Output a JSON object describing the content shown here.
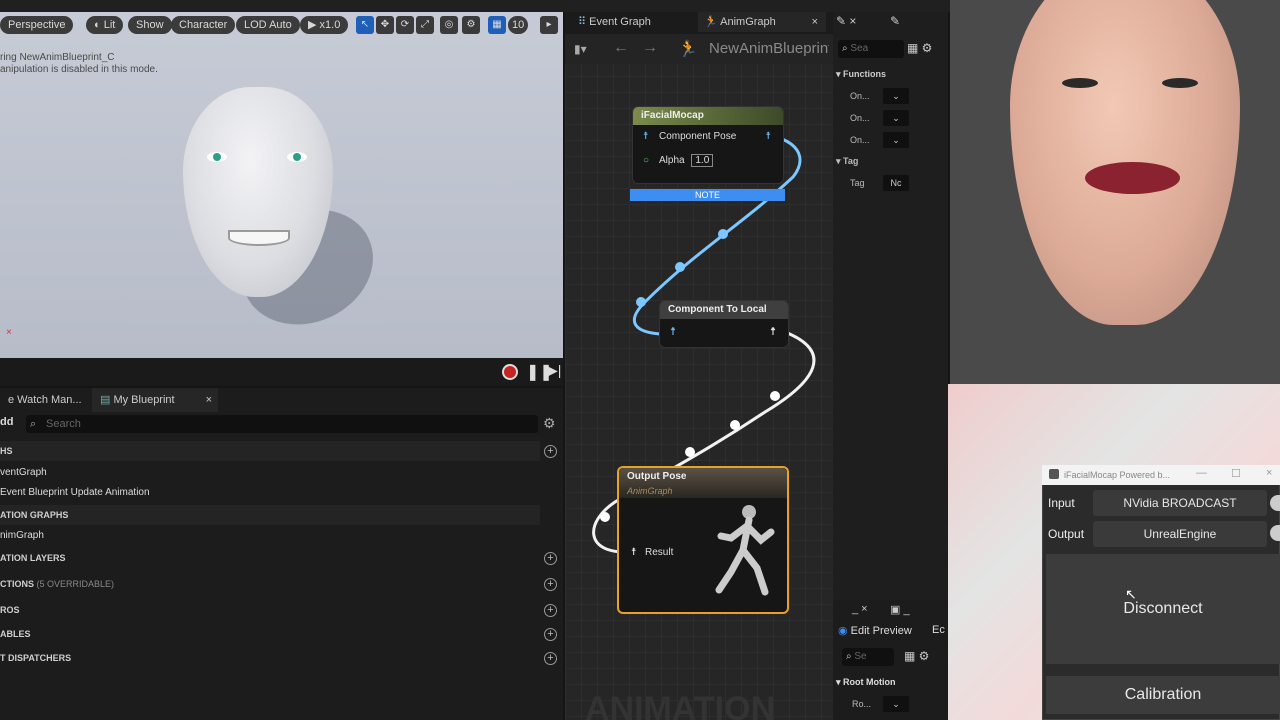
{
  "viewport": {
    "toolbar": [
      "Perspective",
      "Lit",
      "Show",
      "Character",
      "LOD Auto",
      "x1.0",
      "10"
    ],
    "message": "ring NewAnimBlueprint_C\nanipulation is disabled in this mode."
  },
  "blueprint": {
    "tabs": [
      "e Watch Man...",
      "My Blueprint"
    ],
    "add": "dd",
    "search_placeholder": "Search",
    "rows": [
      {
        "text": "HS",
        "sec": true
      },
      {
        "text": "ventGraph",
        "sec": false
      },
      {
        "text": " Event Blueprint Update Animation",
        "sec": false
      },
      {
        "text": "ATION GRAPHS",
        "sec": true
      },
      {
        "text": "nimGraph",
        "sec": false
      },
      {
        "text": "ATION LAYERS",
        "sec": true
      },
      {
        "text": "CTIONS",
        "sec": true,
        "note": "(5 OVERRIDABLE)"
      },
      {
        "text": "ROS",
        "sec": true
      },
      {
        "text": "ABLES",
        "sec": true
      },
      {
        "text": "T DISPATCHERS",
        "sec": true
      }
    ]
  },
  "graph": {
    "tabs": [
      "Event Graph",
      "AnimGraph"
    ],
    "breadcrumb": "NewAnimBlueprint",
    "nodes": {
      "mocap": {
        "title": "iFacialMocap",
        "pin1": "Component Pose",
        "pin2": "Alpha",
        "alpha_value": "1.0",
        "note": "NOTE"
      },
      "c2l": {
        "title": "Component To Local"
      },
      "output": {
        "title": "Output Pose",
        "subtitle": "AnimGraph",
        "pin": "Result"
      }
    },
    "watermark": "ANIMATION"
  },
  "details": {
    "search": "Sea",
    "functions_label": "Functions",
    "fn_rows": [
      "On...",
      "On...",
      "On..."
    ],
    "tag_section": "Tag",
    "tag_label": "Tag",
    "tag_value": "Nc",
    "edit_preview": "Edit Preview",
    "ec": "Ec",
    "search2": "Se",
    "root_motion": "Root Motion",
    "ro": "Ro..."
  },
  "app": {
    "title": "iFacialMocap Powered b...",
    "input_label": "Input",
    "input_value": "NVidia BROADCAST",
    "output_label": "Output",
    "output_value": "UnrealEngine",
    "disconnect": "Disconnect",
    "calibration": "Calibration"
  }
}
